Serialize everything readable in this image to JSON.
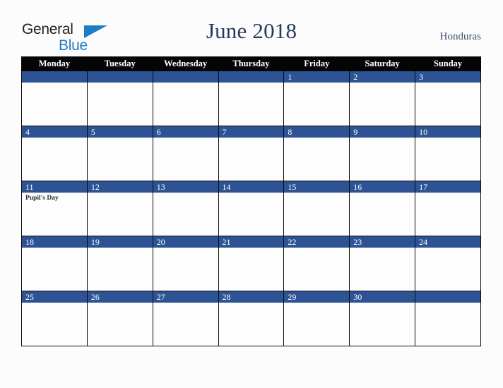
{
  "brand": {
    "word_one": "General",
    "word_two": "Blue",
    "triangle_icon": "triangle-icon",
    "accent_color": "#1f7dc4",
    "text_color": "#231f20"
  },
  "header": {
    "title": "June 2018",
    "country": "Honduras",
    "title_color": "#26395e",
    "country_color": "#3b4f73"
  },
  "calendar": {
    "month": "June",
    "year": "2018",
    "header_bg": "#050505",
    "daybar_bg": "#2e5395",
    "cell_bg": "#fdfdfe",
    "grid_color": "#0b0b0b",
    "weekday_headers": [
      "Monday",
      "Tuesday",
      "Wednesday",
      "Thursday",
      "Friday",
      "Saturday",
      "Sunday"
    ],
    "weeks": [
      [
        {
          "day": "",
          "events": []
        },
        {
          "day": "",
          "events": []
        },
        {
          "day": "",
          "events": []
        },
        {
          "day": "",
          "events": []
        },
        {
          "day": "1",
          "events": []
        },
        {
          "day": "2",
          "events": []
        },
        {
          "day": "3",
          "events": []
        }
      ],
      [
        {
          "day": "4",
          "events": []
        },
        {
          "day": "5",
          "events": []
        },
        {
          "day": "6",
          "events": []
        },
        {
          "day": "7",
          "events": []
        },
        {
          "day": "8",
          "events": []
        },
        {
          "day": "9",
          "events": []
        },
        {
          "day": "10",
          "events": []
        }
      ],
      [
        {
          "day": "11",
          "events": [
            "Pupil's Day"
          ]
        },
        {
          "day": "12",
          "events": []
        },
        {
          "day": "13",
          "events": []
        },
        {
          "day": "14",
          "events": []
        },
        {
          "day": "15",
          "events": []
        },
        {
          "day": "16",
          "events": []
        },
        {
          "day": "17",
          "events": []
        }
      ],
      [
        {
          "day": "18",
          "events": []
        },
        {
          "day": "19",
          "events": []
        },
        {
          "day": "20",
          "events": []
        },
        {
          "day": "21",
          "events": []
        },
        {
          "day": "22",
          "events": []
        },
        {
          "day": "23",
          "events": []
        },
        {
          "day": "24",
          "events": []
        }
      ],
      [
        {
          "day": "25",
          "events": []
        },
        {
          "day": "26",
          "events": []
        },
        {
          "day": "27",
          "events": []
        },
        {
          "day": "28",
          "events": []
        },
        {
          "day": "29",
          "events": []
        },
        {
          "day": "30",
          "events": []
        },
        {
          "day": "",
          "events": []
        }
      ]
    ]
  }
}
